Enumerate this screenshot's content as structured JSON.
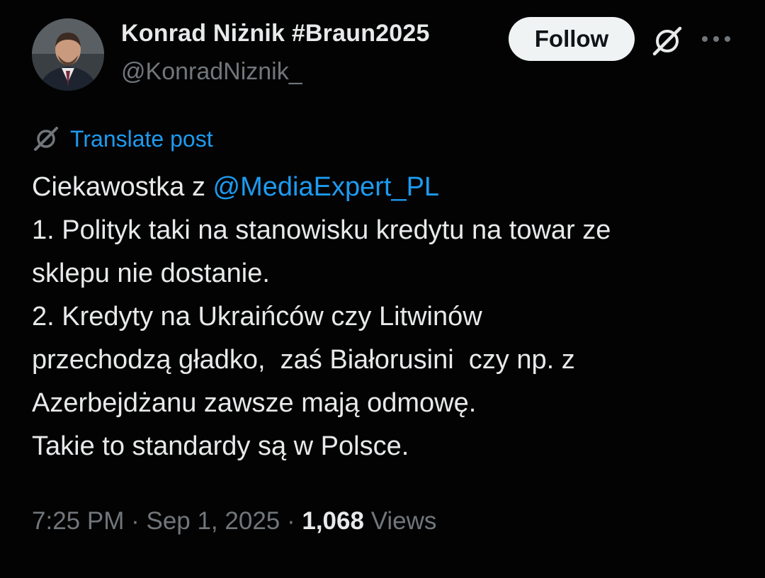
{
  "author": {
    "display_name": "Konrad Niżnik #Braun2025",
    "handle": "@KonradNiznik_"
  },
  "header": {
    "follow_label": "Follow",
    "grok_icon": "grok-icon",
    "more_icon": "more-icon"
  },
  "translate": {
    "label": "Translate post",
    "icon": "translate-icon"
  },
  "post": {
    "line1_prefix": "Ciekawostka z ",
    "mention": "@MediaExpert_PL",
    "line2": "1. Polityk taki na stanowisku kredytu na towar ze",
    "line3": "sklepu nie dostanie.",
    "line4": "2. Kredyty na Ukraińców czy Litwinów",
    "line5": "przechodzą gładko,  zaś Białorusini  czy np. z",
    "line6": "Azerbejdżanu zawsze mają odmowę.",
    "line7": "Takie to standardy są w Polsce."
  },
  "meta": {
    "time": "7:25 PM",
    "separator": " · ",
    "date": "Sep 1, 2025",
    "views_count": "1,068",
    "views_label": "Views"
  },
  "colors": {
    "background": "#030303",
    "text": "#e7e9ea",
    "secondary": "#71767b",
    "link": "#1d9bf0",
    "button_bg": "#eff3f4"
  }
}
